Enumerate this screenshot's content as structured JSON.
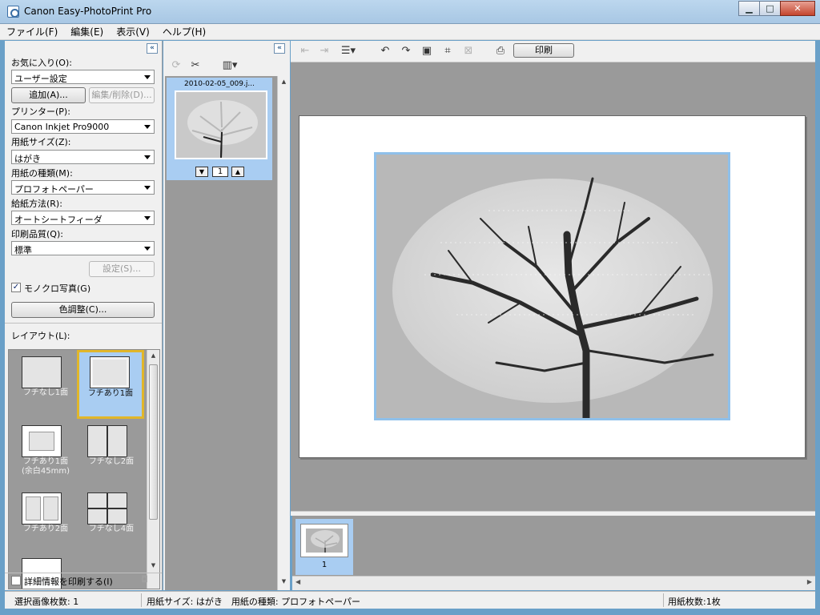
{
  "window": {
    "title": "Canon Easy-PhotoPrint Pro",
    "controls": {
      "minimize": "▁",
      "maximize": "□",
      "close": "✕"
    }
  },
  "menu": [
    {
      "label": "ファイル(F)"
    },
    {
      "label": "編集(E)"
    },
    {
      "label": "表示(V)"
    },
    {
      "label": "ヘルプ(H)"
    }
  ],
  "left": {
    "favorites_label": "お気に入り(O):",
    "favorites_value": "ユーザー設定",
    "add_button": "追加(A)...",
    "edit_delete_button": "編集/削除(D)...",
    "printer_label": "プリンター(P):",
    "printer_value": "Canon Inkjet Pro9000",
    "paper_size_label": "用紙サイズ(Z):",
    "paper_size_value": "はがき",
    "media_type_label": "用紙の種類(M):",
    "media_type_value": "プロフォトペーパー",
    "paper_source_label": "給紙方法(R):",
    "paper_source_value": "オートシートフィーダ",
    "quality_label": "印刷品質(Q):",
    "quality_value": "標準",
    "settings_button": "設定(S)...",
    "mono_label": "モノクロ写真(G)",
    "mono_checked": "✓",
    "color_adjust_button": "色調整(C)...",
    "layout_label": "レイアウト(L):",
    "layouts": [
      {
        "caption": "フチなし1面"
      },
      {
        "caption": "フチあり1面",
        "selected": true
      },
      {
        "caption": "フチあり1面",
        "caption2": "(余白45mm)"
      },
      {
        "caption": "フチなし2面"
      },
      {
        "caption": "フチあり2面"
      },
      {
        "caption": "フチなし4面"
      }
    ],
    "print_details_label": "詳細情報を印刷する(I)"
  },
  "middle": {
    "photo_filename": "2010-02-05_009.j...",
    "copies": "1"
  },
  "toolbar": {
    "print_button": "印刷"
  },
  "filmstrip": {
    "page_number": "1"
  },
  "status": {
    "selected_images": "選択画像枚数: 1",
    "paper_info": "用紙サイズ: はがき　用紙の種類: プロフォトペーパー",
    "page_count": "用紙枚数:1枚"
  },
  "colors": {
    "panel_gray": "#9a9a9a",
    "selection_blue": "#a9cdf2",
    "selection_gold": "#e1b62a",
    "photo_border": "#8fc0ea"
  },
  "icons": [
    "app-icon",
    "collapse-icon",
    "rotate-icon",
    "trim-icon",
    "layout-icon",
    "arrow-up-icon",
    "arrow-down-icon",
    "camera-icon"
  ]
}
